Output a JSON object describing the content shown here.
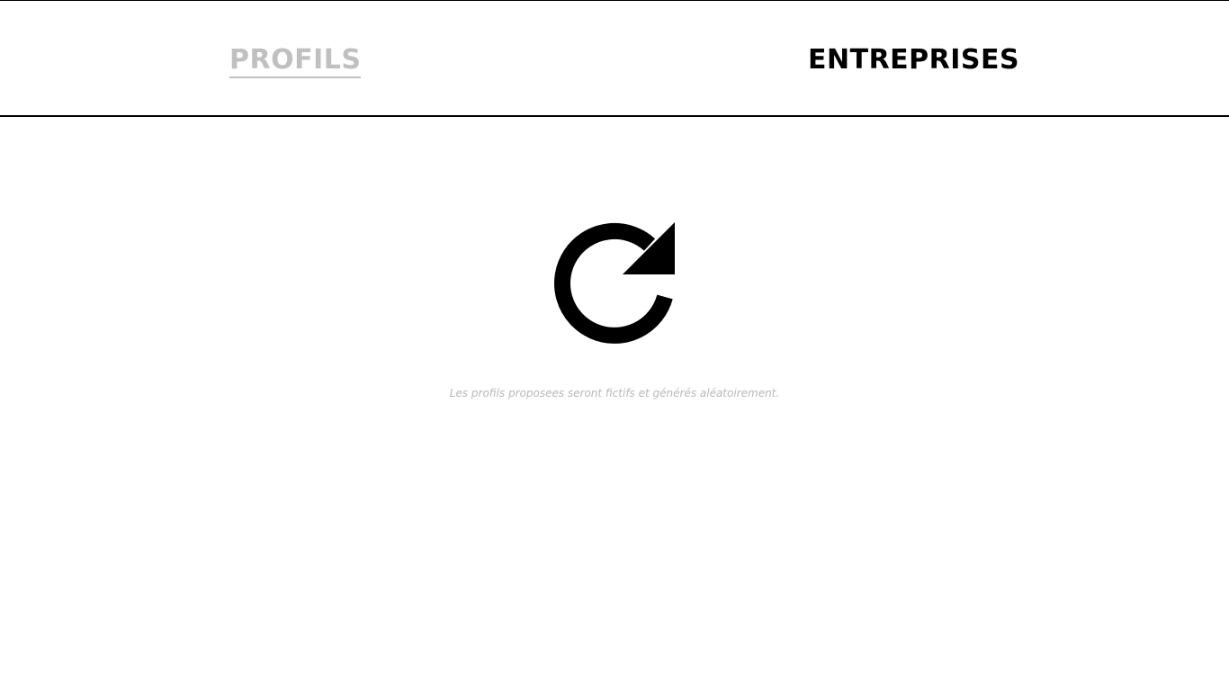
{
  "tabs": {
    "profils": "PROFILS",
    "entreprises": "ENTREPRISES"
  },
  "tabs_state": {
    "profils_color": "#c0c0c0",
    "entreprises_color": "#000000"
  },
  "refresh": {
    "icon": "refresh-icon"
  },
  "disclaimer": "Les profils proposees seront fictifs et générés aléatoirement."
}
